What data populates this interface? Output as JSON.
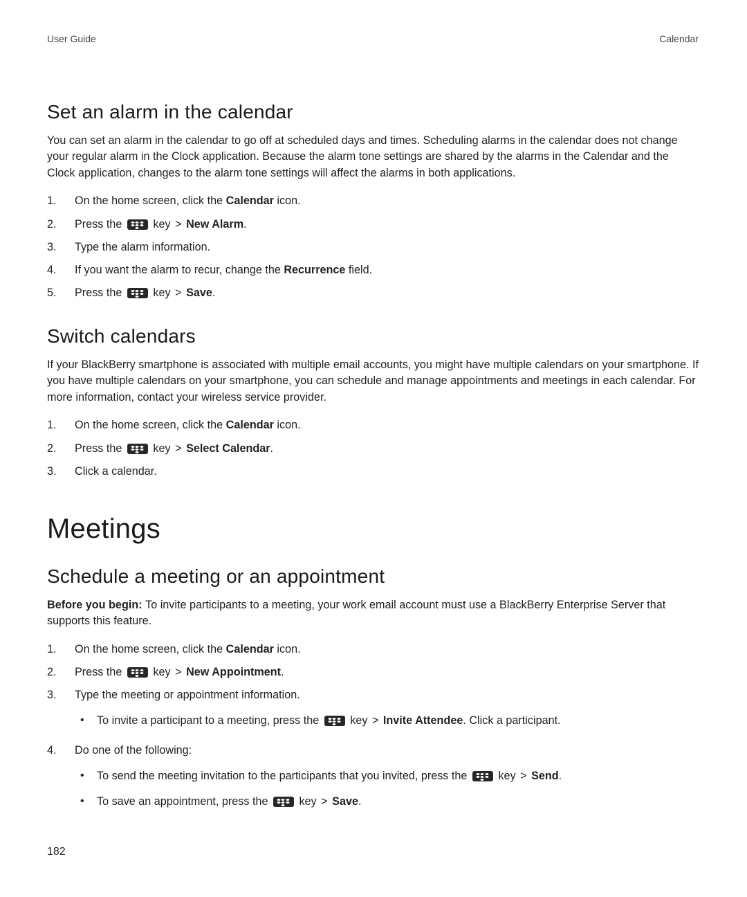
{
  "header": {
    "left": "User Guide",
    "right": "Calendar"
  },
  "page_number": "182",
  "section1": {
    "title": "Set an alarm in the calendar",
    "para": "You can set an alarm in the calendar to go off at scheduled days and times. Scheduling alarms in the calendar does not change your regular alarm in the Clock application. Because the alarm tone settings are shared by the alarms in the Calendar and the Clock application, changes to the alarm tone settings will affect the alarms in both applications.",
    "steps": {
      "s1a": "On the home screen, click the ",
      "s1b": "Calendar",
      "s1c": " icon.",
      "s2a": "Press the ",
      "key": " key ",
      "gt": ">",
      "s2b": "New Alarm",
      "period": ".",
      "s3": "Type the alarm information.",
      "s4a": "If you want the alarm to recur, change the ",
      "s4b": "Recurrence",
      "s4c": " field.",
      "s5a": "Press the ",
      "s5b": "Save"
    }
  },
  "section2": {
    "title": "Switch calendars",
    "para": "If your BlackBerry smartphone is associated with multiple email accounts, you might have multiple calendars on your smartphone. If you have multiple calendars on your smartphone, you can schedule and manage appointments and meetings in each calendar. For more information, contact your wireless service provider.",
    "steps": {
      "s1a": "On the home screen, click the ",
      "s1b": "Calendar",
      "s1c": " icon.",
      "s2a": "Press the ",
      "key": " key ",
      "gt": ">",
      "s2b": "Select Calendar",
      "period": ".",
      "s3": "Click a calendar."
    }
  },
  "major": {
    "title": "Meetings"
  },
  "section3": {
    "title": "Schedule a meeting or an appointment",
    "before_label": "Before you begin: ",
    "before_text": "To invite participants to a meeting, your work email account must use a BlackBerry Enterprise Server that supports this feature.",
    "steps": {
      "s1a": "On the home screen, click the ",
      "s1b": "Calendar",
      "s1c": " icon.",
      "s2a": "Press the ",
      "key": " key ",
      "gt": ">",
      "s2b": "New Appointment",
      "period": ".",
      "s3": "Type the meeting or appointment information.",
      "s3_sub1a": "To invite a participant to a meeting, press the ",
      "s3_sub1b": "Invite Attendee",
      "s3_sub1c": ". Click a participant.",
      "s4": "Do one of the following:",
      "s4_sub1a": "To send the meeting invitation to the participants that you invited, press the ",
      "s4_sub1b": "Send",
      "s4_sub2a": "To save an appointment, press the ",
      "s4_sub2b": "Save"
    }
  }
}
